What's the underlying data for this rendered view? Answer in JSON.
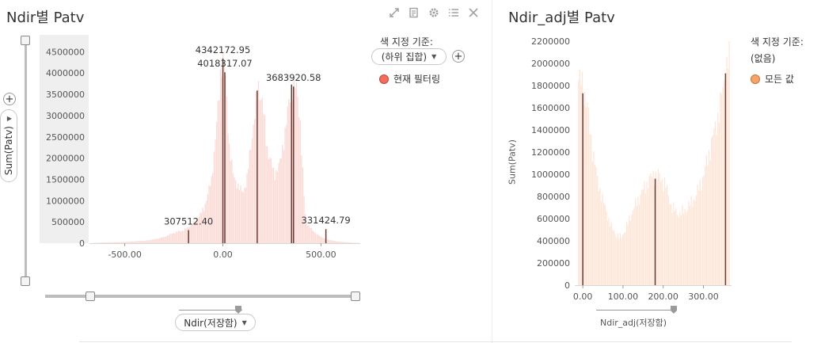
{
  "left": {
    "title": "Ndir별 Patv",
    "toolbar_icons": [
      "expand-icon",
      "notes-icon",
      "gear-icon",
      "list-icon",
      "close-icon"
    ],
    "color_by_label": "색 지정 기준:",
    "color_by_value": "(하위 집합)",
    "legend_item": "현재 필터링",
    "legend_color": "#f26d5c",
    "y_axis_selector": "Sum(Patv)",
    "x_axis_selector": "Ndir(저장함)"
  },
  "right": {
    "title": "Ndir_adj별 Patv",
    "color_by_label": "색 지정 기준:",
    "color_by_value": "(없음)",
    "legend_item": "모든 값",
    "legend_color": "#f5a36a",
    "y_axis_label": "Sum(Patv)",
    "x_axis_label": "Ndir_adj(저장함)"
  },
  "chart_data": [
    {
      "type": "bar",
      "title": "Ndir별 Patv",
      "xlabel": "Ndir(저장함)",
      "ylabel": "Sum(Patv)",
      "xlim": [
        -680,
        700
      ],
      "ylim": [
        0,
        4600000
      ],
      "x_ticks": [
        -500,
        0,
        500
      ],
      "x_tick_labels": [
        "-500.00",
        "0.00",
        "500.00"
      ],
      "y_ticks": [
        0,
        500000,
        1000000,
        1500000,
        2000000,
        2500000,
        3000000,
        3500000,
        4000000,
        4500000
      ],
      "y_tick_labels": [
        "0",
        "500000",
        "1000000",
        "1500000",
        "2000000",
        "2500000",
        "3000000",
        "3500000",
        "4000000",
        "4500000"
      ],
      "bar_color": "#fadbd6",
      "envelope": [
        [
          -680,
          0
        ],
        [
          -600,
          20000
        ],
        [
          -500,
          30000
        ],
        [
          -400,
          60000
        ],
        [
          -350,
          90000
        ],
        [
          -300,
          150000
        ],
        [
          -250,
          250000
        ],
        [
          -200,
          310000
        ],
        [
          -150,
          480000
        ],
        [
          -100,
          800000
        ],
        [
          -60,
          1500000
        ],
        [
          -30,
          3000000
        ],
        [
          -10,
          4300000
        ],
        [
          0,
          4340000
        ],
        [
          10,
          3900000
        ],
        [
          30,
          2300000
        ],
        [
          50,
          1600000
        ],
        [
          80,
          1300000
        ],
        [
          100,
          1200000
        ],
        [
          120,
          1500000
        ],
        [
          150,
          2700000
        ],
        [
          170,
          3400000
        ],
        [
          180,
          3700000
        ],
        [
          200,
          3300000
        ],
        [
          220,
          2300000
        ],
        [
          260,
          1600000
        ],
        [
          290,
          1900000
        ],
        [
          320,
          2800000
        ],
        [
          340,
          3500000
        ],
        [
          355,
          3700000
        ],
        [
          375,
          3600000
        ],
        [
          390,
          3000000
        ],
        [
          400,
          2000000
        ],
        [
          410,
          1200000
        ],
        [
          420,
          500000
        ],
        [
          450,
          330000
        ],
        [
          480,
          200000
        ],
        [
          520,
          100000
        ],
        [
          580,
          40000
        ],
        [
          700,
          0
        ]
      ],
      "highlight_bars": [
        {
          "x": -175,
          "value": 307512.4,
          "label": "307512.40"
        },
        {
          "x": 0,
          "value": 4342172.95,
          "label": "4342172.95"
        },
        {
          "x": 10,
          "value": 4018317.07,
          "label": "4018317.07"
        },
        {
          "x": 175,
          "value": 3590000,
          "label": ""
        },
        {
          "x": 350,
          "value": 3730000,
          "label": ""
        },
        {
          "x": 360,
          "value": 3683920.58,
          "label": "3683920.58"
        },
        {
          "x": 525,
          "value": 331424.79,
          "label": "331424.79"
        }
      ],
      "highlight_color": "#6b3b36"
    },
    {
      "type": "bar",
      "title": "Ndir_adj별 Patv",
      "xlabel": "Ndir_adj(저장함)",
      "ylabel": "Sum(Patv)",
      "xlim": [
        -20,
        370
      ],
      "ylim": [
        0,
        2200000
      ],
      "x_ticks": [
        0,
        100,
        200,
        300
      ],
      "x_tick_labels": [
        "0.00",
        "100.00",
        "200.00",
        "300.00"
      ],
      "y_ticks": [
        0,
        200000,
        400000,
        600000,
        800000,
        1000000,
        1200000,
        1400000,
        1600000,
        1800000,
        2000000,
        2200000
      ],
      "y_tick_labels": [
        "0",
        "200000",
        "400000",
        "600000",
        "800000",
        "1000000",
        "1200000",
        "1400000",
        "1600000",
        "1800000",
        "2000000",
        "2200000"
      ],
      "bar_color": "#fde6d8",
      "envelope": [
        [
          -12,
          1850000
        ],
        [
          0,
          1800000
        ],
        [
          10,
          1600000
        ],
        [
          20,
          1300000
        ],
        [
          35,
          950000
        ],
        [
          50,
          750000
        ],
        [
          70,
          520000
        ],
        [
          90,
          420000
        ],
        [
          105,
          500000
        ],
        [
          120,
          650000
        ],
        [
          140,
          800000
        ],
        [
          160,
          930000
        ],
        [
          175,
          1000000
        ],
        [
          190,
          980000
        ],
        [
          205,
          900000
        ],
        [
          220,
          700000
        ],
        [
          240,
          640000
        ],
        [
          260,
          700000
        ],
        [
          280,
          800000
        ],
        [
          300,
          1000000
        ],
        [
          320,
          1300000
        ],
        [
          340,
          1600000
        ],
        [
          355,
          1950000
        ],
        [
          365,
          2100000
        ]
      ],
      "highlight_bars": [
        {
          "x": 0,
          "value": 1730000,
          "label": ""
        },
        {
          "x": 180,
          "value": 960000,
          "label": ""
        },
        {
          "x": 355,
          "value": 1910000,
          "label": ""
        }
      ],
      "highlight_color": "#6b3b36"
    }
  ]
}
